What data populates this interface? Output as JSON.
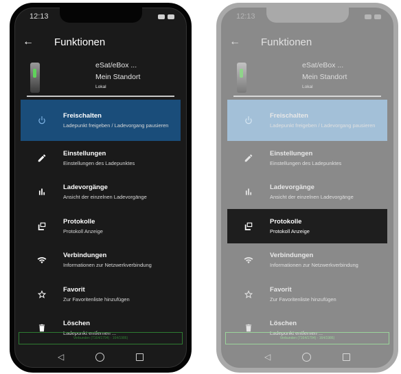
{
  "status": {
    "time": "12:13"
  },
  "appbar": {
    "back_icon": "arrow-left-icon",
    "title": "Funktionen"
  },
  "device": {
    "name": "eSat/eBox ...",
    "location": "Mein Standort",
    "mode": "Lokal"
  },
  "menu": [
    {
      "key": "unlock",
      "icon": "power-icon",
      "title": "Freischalten",
      "subtitle": "Ladepunkt freigeben / Ladevorgang pausieren"
    },
    {
      "key": "settings",
      "icon": "pencil-icon",
      "title": "Einstellungen",
      "subtitle": "Einstellungen des Ladepunktes"
    },
    {
      "key": "charges",
      "icon": "bar-chart-icon",
      "title": "Ladevorgänge",
      "subtitle": "Ansicht der einzelnen Ladevorgänge"
    },
    {
      "key": "logs",
      "icon": "log-stack-icon",
      "title": "Protokolle",
      "subtitle": "Protokoll Anzeige"
    },
    {
      "key": "connections",
      "icon": "wifi-icon",
      "title": "Verbindungen",
      "subtitle": "Informationen zur Netzwerkverbindung"
    },
    {
      "key": "favorite",
      "icon": "star-icon",
      "title": "Favorit",
      "subtitle": "Zur Favoritenliste hinzufügen"
    },
    {
      "key": "delete",
      "icon": "trash-icon",
      "title": "Löschen",
      "subtitle": "Ladepunkt entfernen ..."
    }
  ],
  "connection": {
    "text": "Verbunden (7164/1794) - 164/1986)"
  },
  "navbar": {
    "back": "◁"
  },
  "colors": {
    "active_left": "#1a4d7a",
    "active_right": "#a3c0d8",
    "highlight_right": "#1e1e1e",
    "conn_green": "#2e7d32"
  }
}
